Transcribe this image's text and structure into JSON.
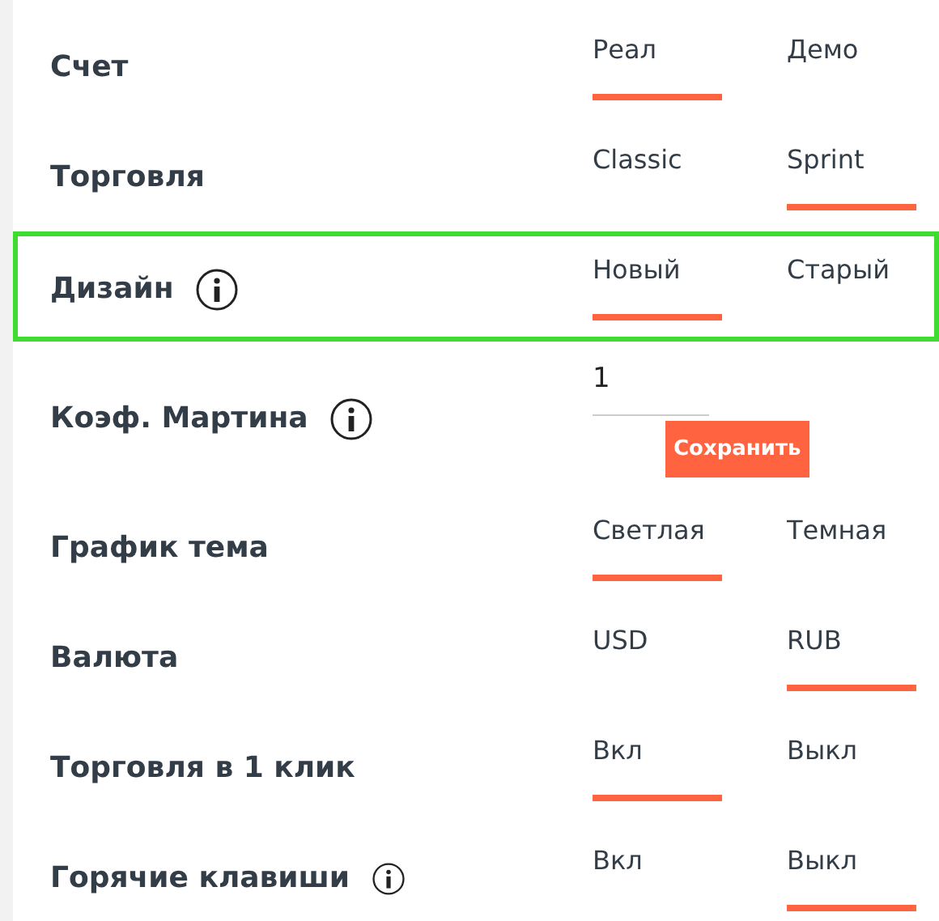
{
  "settings": [
    {
      "kind": "toggle",
      "label": "Счет",
      "options": [
        {
          "label": "Реал",
          "selected": true
        },
        {
          "label": "Демо",
          "selected": false
        }
      ]
    },
    {
      "kind": "toggle",
      "label": "Торговля",
      "options": [
        {
          "label": "Classic",
          "selected": false
        },
        {
          "label": "Sprint",
          "selected": true
        }
      ]
    },
    {
      "kind": "toggle",
      "label": "Дизайн",
      "info_icon": true,
      "highlighted": true,
      "options": [
        {
          "label": "Новый",
          "selected": true
        },
        {
          "label": "Старый",
          "selected": false
        }
      ]
    },
    {
      "kind": "input",
      "label": "Коэф. Мартина",
      "info_icon": true,
      "value": "1",
      "button": "Сохранить"
    },
    {
      "kind": "toggle",
      "label": "График тема",
      "options": [
        {
          "label": "Светлая",
          "selected": true
        },
        {
          "label": "Темная",
          "selected": false
        }
      ]
    },
    {
      "kind": "toggle",
      "label": "Валюта",
      "options": [
        {
          "label": "USD",
          "selected": false
        },
        {
          "label": "RUB",
          "selected": true
        }
      ]
    },
    {
      "kind": "toggle",
      "label": "Торговля в 1 клик",
      "options": [
        {
          "label": "Вкл",
          "selected": true
        },
        {
          "label": "Выкл",
          "selected": false
        }
      ]
    },
    {
      "kind": "toggle",
      "label": "Горячие клавиши",
      "info_icon": true,
      "info_icon_small": true,
      "options": [
        {
          "label": "Вкл",
          "selected": false
        },
        {
          "label": "Выкл",
          "selected": true
        }
      ]
    }
  ]
}
